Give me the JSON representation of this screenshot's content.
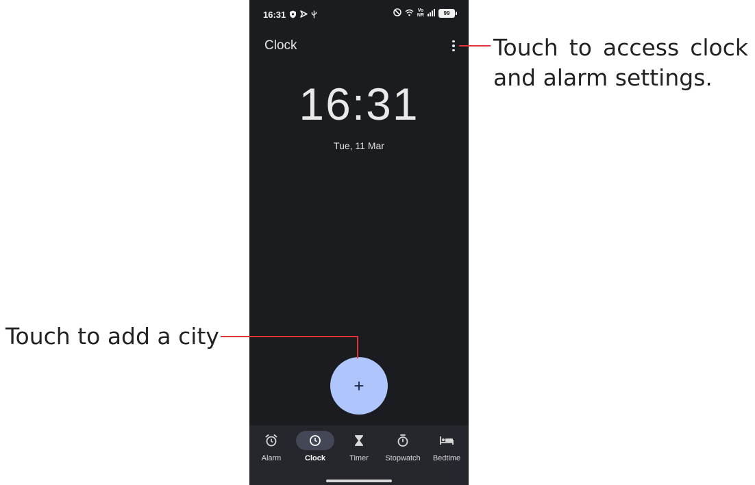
{
  "statusbar": {
    "time": "16:31",
    "left_icons": [
      "shield-icon",
      "cast-icon",
      "usb-icon"
    ],
    "right_icons": [
      "nfc-icon",
      "wifi-icon",
      "signal-icon"
    ],
    "network_label_top": "Vo",
    "network_label_bottom": "NR",
    "battery": "99"
  },
  "header": {
    "title": "Clock",
    "menu_icon": "more-vert-icon"
  },
  "clock": {
    "time": "16:31",
    "date": "Tue, 11 Mar"
  },
  "fab": {
    "label": "+"
  },
  "bottom_nav": {
    "items": [
      {
        "label": "Alarm",
        "icon": "alarm-icon"
      },
      {
        "label": "Clock",
        "icon": "clock-icon",
        "active": true
      },
      {
        "label": "Timer",
        "icon": "hourglass-icon"
      },
      {
        "label": "Stopwatch",
        "icon": "stopwatch-icon"
      },
      {
        "label": "Bedtime",
        "icon": "bed-icon"
      }
    ]
  },
  "callouts": {
    "settings_line1": "Touch to access clock",
    "settings_line2": "and alarm settings.",
    "add_city": "Touch to add a city"
  },
  "colors": {
    "background": "#1b1c20",
    "nav_background": "#26272d",
    "fab": "#aec6fb",
    "callout_line": "#e5333a"
  }
}
